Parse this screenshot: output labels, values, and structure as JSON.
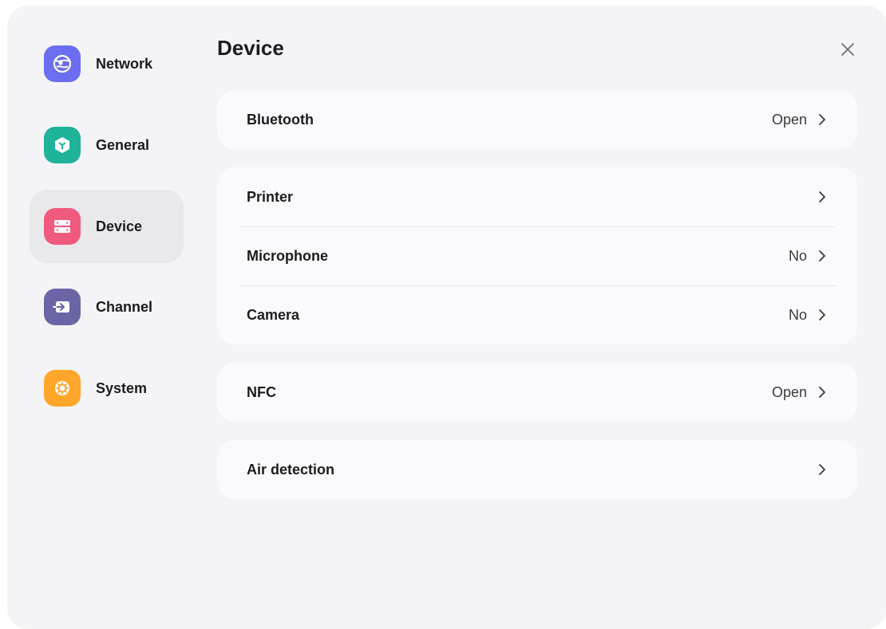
{
  "sidebar": {
    "items": [
      {
        "label": "Network",
        "icon": "network-globe-icon",
        "color": "#6b6ef0",
        "active": false
      },
      {
        "label": "General",
        "icon": "general-cube-icon",
        "color": "#1fb39a",
        "active": false
      },
      {
        "label": "Device",
        "icon": "device-server-icon",
        "color": "#f05a7e",
        "active": true
      },
      {
        "label": "Channel",
        "icon": "channel-input-icon",
        "color": "#6a66a6",
        "active": false
      },
      {
        "label": "System",
        "icon": "system-gear-icon",
        "color": "#ffa62b",
        "active": false
      }
    ]
  },
  "main": {
    "title": "Device",
    "close_icon": "close-icon",
    "groups": [
      {
        "rows": [
          {
            "label": "Bluetooth",
            "value": "Open"
          }
        ]
      },
      {
        "rows": [
          {
            "label": "Printer",
            "value": ""
          },
          {
            "label": "Microphone",
            "value": "No"
          },
          {
            "label": "Camera",
            "value": "No"
          }
        ]
      },
      {
        "rows": [
          {
            "label": "NFC",
            "value": "Open"
          }
        ]
      },
      {
        "rows": [
          {
            "label": "Air detection",
            "value": ""
          }
        ]
      }
    ]
  },
  "colors": {
    "window_bg": "#f4f4f6",
    "card_bg": "#fafafc",
    "active_nav_bg": "#e9e9eb",
    "text": "#1c1c1e"
  }
}
